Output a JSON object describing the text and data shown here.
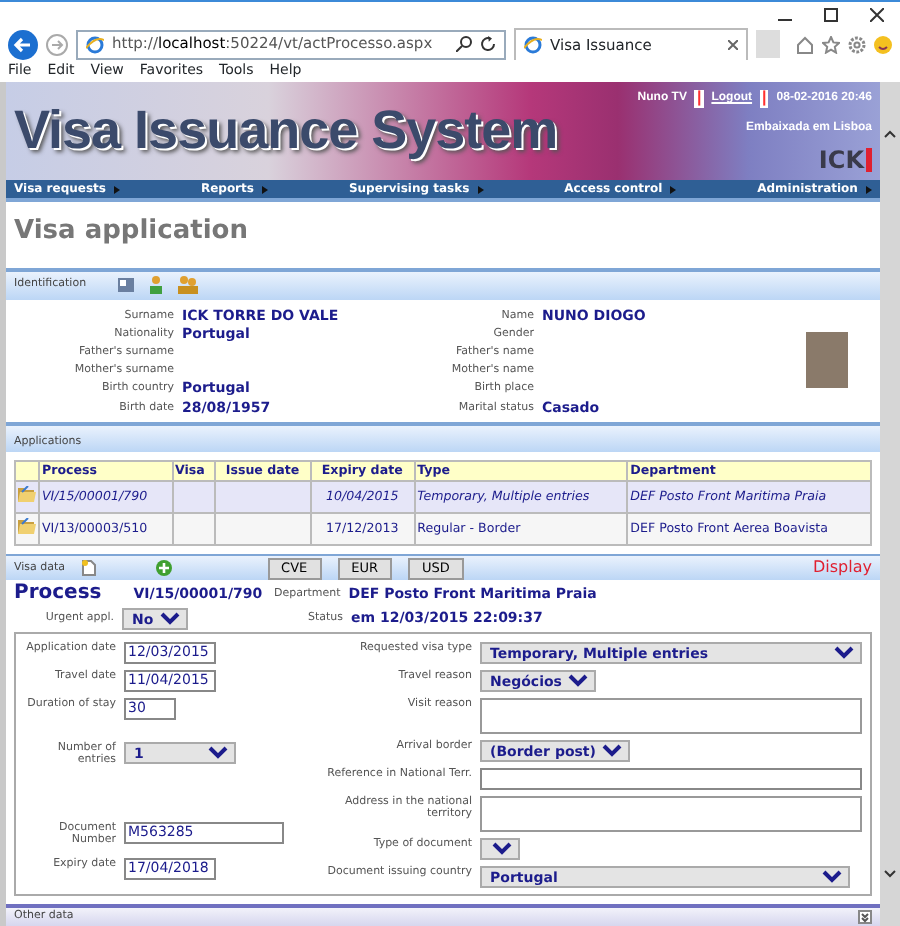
{
  "browser": {
    "url": "http://**localhost**:50224/vt/actProcesso.aspx",
    "tab_title": "Visa Issuance",
    "menu": [
      "File",
      "Edit",
      "View",
      "Favorites",
      "Tools",
      "Help"
    ]
  },
  "header": {
    "title": "Visa Issuance System",
    "logo": "ICK",
    "user_bar": [
      {
        "kind": "text",
        "text": "Nuno TV"
      },
      {
        "kind": "separator",
        "text": "|"
      },
      {
        "kind": "link",
        "text": "Logout"
      },
      {
        "kind": "separator",
        "text": "|"
      },
      {
        "kind": "text",
        "text": "08-02-2016 20:46"
      }
    ],
    "embassy": "Embaixada em Lisboa"
  },
  "nav": [
    "Visa requests",
    "Reports",
    "Supervising tasks",
    "Access control",
    "Administration"
  ],
  "page_title": "Visa application",
  "identification": {
    "label": "Identification",
    "left": [
      {
        "label": "Surname",
        "value": "ICK TORRE DO VALE"
      },
      {
        "label": "Nationality",
        "value": "Portugal"
      },
      {
        "label": "Father's surname"
      },
      {
        "label": "Mother's surname"
      },
      {
        "label": "Birth country",
        "value": "Portugal"
      },
      {
        "label": "Birth date",
        "value": "28/08/1957"
      }
    ],
    "right": [
      {
        "label": "Name",
        "value": "NUNO DIOGO"
      },
      {
        "label": "Gender"
      },
      {
        "label": "Father's name"
      },
      {
        "label": "Mother's name"
      },
      {
        "label": "Birth place"
      },
      {
        "label": "Marital status",
        "value": "Casado"
      }
    ]
  },
  "applications": {
    "label": "Applications",
    "columns": [
      "Process",
      "Visa",
      "Issue date",
      "Expiry date",
      "Type",
      "Department"
    ],
    "rows": [
      {
        "selected": true,
        "cells": [
          "VI/15/00001/790",
          "",
          "",
          "10/04/2015",
          "Temporary, Multiple entries",
          "DEF Posto Front Maritima Praia"
        ]
      },
      {
        "selected": false,
        "cells": [
          "VI/13/00003/510",
          "",
          "",
          "17/12/2013",
          "Regular - Border",
          "DEF Posto Front Aerea Boavista"
        ]
      }
    ]
  },
  "visa_data": {
    "label": "Visa data",
    "currencies": [
      "CVE",
      "EUR",
      "USD"
    ],
    "display": "Display"
  },
  "process": {
    "title": "Process",
    "number": "VI/15/00001/790",
    "department_label": "Department",
    "department": "DEF Posto Front Maritima Praia",
    "urgent_label": "Urgent appl.",
    "urgent": "No",
    "status_label": "Status",
    "status": "em 12/03/2015 22:09:37"
  },
  "form": {
    "left_top": [
      {
        "kind": "input",
        "label": "Application date",
        "value": "12/03/2015"
      },
      {
        "kind": "input",
        "label": "Travel date",
        "value": "11/04/2015"
      },
      {
        "kind": "input",
        "label": "Duration of stay",
        "value": "30"
      },
      {
        "kind": "select",
        "label": "Number of entries",
        "value": "1"
      }
    ],
    "left_bottom": [
      {
        "kind": "input",
        "label": "Document Number",
        "value": "M563285"
      },
      {
        "kind": "input",
        "label": "Expiry date",
        "value": "17/04/2018"
      }
    ],
    "right": [
      {
        "kind": "select",
        "label": "Requested visa type",
        "value": "Temporary, Multiple entries"
      },
      {
        "kind": "select",
        "label": "Travel reason",
        "value": "Negócios"
      },
      {
        "kind": "textarea",
        "label": "Visit reason"
      },
      {
        "kind": "select",
        "label": "Arrival border",
        "value": "(Border post)"
      },
      {
        "kind": "input",
        "label": "Reference in National Terr."
      },
      {
        "kind": "textarea",
        "label": "Address in the national territory"
      },
      {
        "kind": "select",
        "label": "Type of document"
      },
      {
        "kind": "select",
        "label": "Document issuing country",
        "value": "Portugal"
      }
    ]
  },
  "other_data": {
    "label": "Other data"
  }
}
